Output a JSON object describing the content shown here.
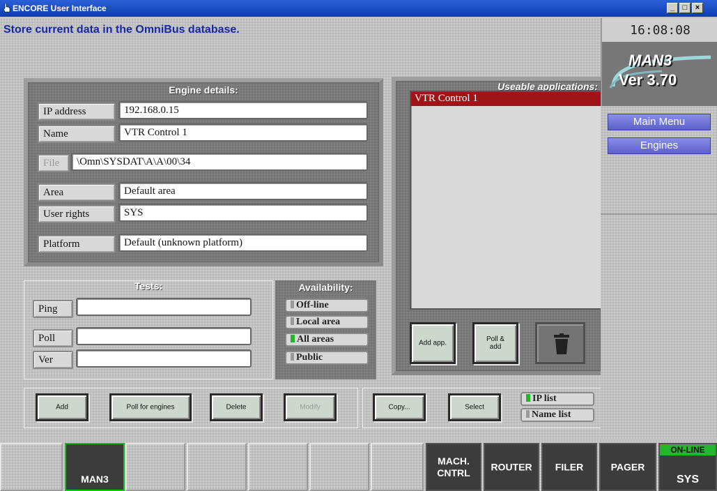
{
  "window": {
    "title": "ENCORE User Interface"
  },
  "status": {
    "message": "Store current data in the OmniBus database.",
    "time": "16:08:08"
  },
  "engine_details": {
    "title": "Engine details:",
    "fields": [
      {
        "label": "IP address",
        "value": "192.168.0.15"
      },
      {
        "label": "Name",
        "value": "VTR Control 1"
      },
      {
        "label": "File",
        "value": "\\Omn\\SYSDAT\\A\\A\\00\\34"
      },
      {
        "label": "Area",
        "value": "Default area"
      },
      {
        "label": "User rights",
        "value": "SYS"
      },
      {
        "label": "Platform",
        "value": "Default (unknown platform)"
      }
    ]
  },
  "apps": {
    "title": "Useable applications:",
    "items": [
      {
        "label": "VTR Control 1",
        "selected": true
      }
    ],
    "add_app": "Add app.",
    "poll_add": "Poll & add",
    "trash": "trash-icon"
  },
  "tests": {
    "title": "Tests:",
    "rows": [
      {
        "label": "Ping",
        "value": ""
      },
      {
        "label": "Poll",
        "value": ""
      },
      {
        "label": "Ver",
        "value": ""
      }
    ]
  },
  "availability": {
    "title": "Availability:",
    "options": [
      {
        "label": "Off-line",
        "selected": false
      },
      {
        "label": "Local area",
        "selected": false
      },
      {
        "label": "All areas",
        "selected": true
      },
      {
        "label": "Public",
        "selected": false
      }
    ]
  },
  "actions": {
    "add": "Add",
    "poll_for_engines": "Poll for engines",
    "delete": "Delete",
    "modify": "Modify",
    "copy": "Copy...",
    "select": "Select",
    "ip_list": "IP list",
    "name_list": "Name list"
  },
  "side": {
    "logo_top": "MAN3",
    "logo_version": "Ver 3.70",
    "main_menu": "Main Menu",
    "engines": "Engines"
  },
  "tabs": {
    "man3": "MAN3",
    "mach_cntrl": "MACH.\nCNTRL",
    "router": "ROUTER",
    "filer": "FILER",
    "pager": "PAGER",
    "sys": "SYS",
    "online": "ON-LINE"
  },
  "colors": {
    "accent_blue": "#1727a8",
    "selected_red": "#a01418",
    "online_green": "#23b52a",
    "menu_purple": "#6a6ed8"
  }
}
